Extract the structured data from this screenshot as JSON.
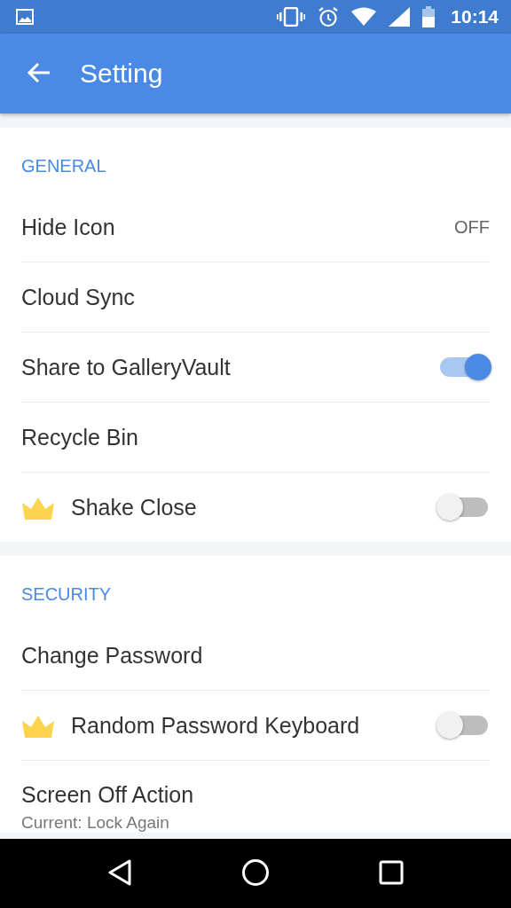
{
  "status_bar": {
    "time": "10:14"
  },
  "app_bar": {
    "title": "Setting"
  },
  "sections": [
    {
      "title": "GENERAL",
      "items": [
        {
          "kind": "value",
          "label": "Hide Icon",
          "value": "OFF",
          "premium": false
        },
        {
          "kind": "plain",
          "label": "Cloud Sync",
          "premium": false
        },
        {
          "kind": "toggle",
          "label": "Share to GalleryVault",
          "on": true,
          "premium": false
        },
        {
          "kind": "plain",
          "label": "Recycle Bin",
          "premium": false
        },
        {
          "kind": "toggle",
          "label": "Shake Close",
          "on": false,
          "premium": true
        }
      ]
    },
    {
      "title": "SECURITY",
      "items": [
        {
          "kind": "plain",
          "label": "Change Password",
          "premium": false
        },
        {
          "kind": "toggle",
          "label": "Random Password Keyboard",
          "on": false,
          "premium": true
        },
        {
          "kind": "subtitle",
          "label": "Screen Off Action",
          "subtitle": "Current: Lock Again",
          "premium": false
        }
      ]
    }
  ]
}
